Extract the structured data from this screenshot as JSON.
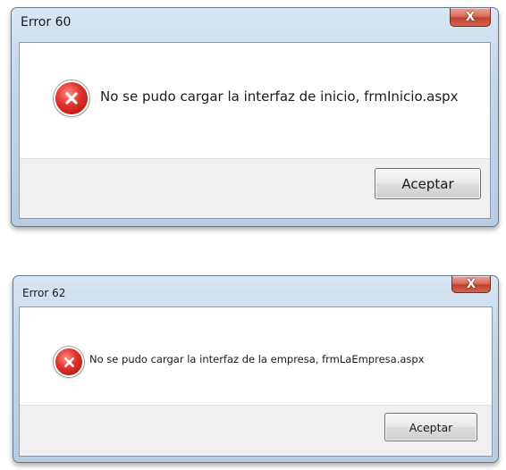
{
  "dialogs": [
    {
      "title": "Error 60",
      "close_glyph": "X",
      "icon": "error-icon",
      "message": "No se pudo cargar la interfaz de inicio, frmInicio.aspx",
      "button_label": "Aceptar"
    },
    {
      "title": "Error 62",
      "close_glyph": "X",
      "icon": "error-icon",
      "message": "No se pudo cargar la interfaz de la empresa, frmLaEmpresa.aspx",
      "button_label": "Aceptar"
    }
  ],
  "colors": {
    "close_button": "#c94a35",
    "error_icon": "#d42a22",
    "frame": "#c5d6e8"
  }
}
